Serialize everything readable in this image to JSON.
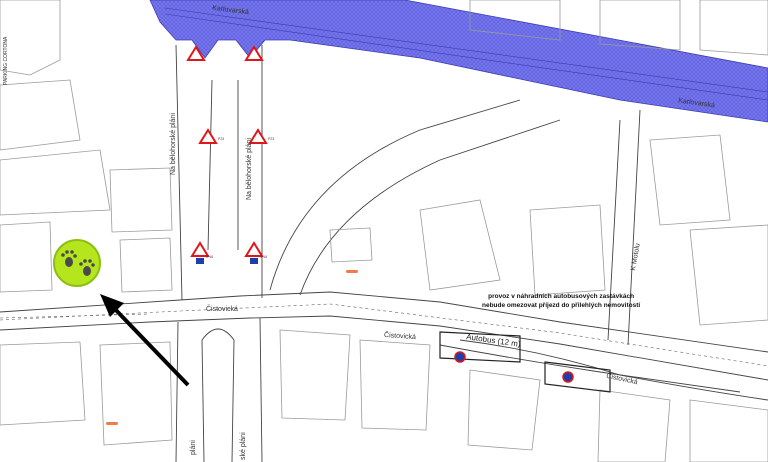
{
  "streets": {
    "karlovarska_top": "Karlovarská",
    "karlovarska_right": "Karlovarská",
    "bilohorske_left": "Na bělohorské pláni",
    "bilohorske_right": "Na bělohorské pláni",
    "bilohorske_bottom_left": "pláni",
    "bilohorske_bottom_right": "ské pláni",
    "cistovicka_main": "Čistovická",
    "cistovicka_lane": "Čistovická",
    "cistovicka_lane_right": "Čistovická",
    "k_motolu": "K Motolu",
    "parking_corner": "PARKING CORTONA"
  },
  "notice": {
    "line1": "provoz v náhradních autobusových zastávkách",
    "line2": "nebude omezovat příjezd do přilehlých nemovitostí"
  },
  "bus_lane_label": "Autobus (12 m)",
  "sign_codes": {
    "sign_a": "P23",
    "sign_b": "P23",
    "sign_c": "IP16",
    "sign_d": "IP16"
  },
  "colors": {
    "tram_area": "#7a7af0",
    "badge_fill": "#b5e61d",
    "badge_ring": "#8cbf14",
    "arrow": "#000000",
    "sign_red": "#e0161b",
    "marker_blue": "#1f3fa8"
  },
  "icons": {
    "badge": "paw-prints-icon",
    "arrow": "pointer-arrow-icon",
    "sign": "warning-triangle-icon",
    "bus_stop": "bus-stop-marker-icon"
  }
}
